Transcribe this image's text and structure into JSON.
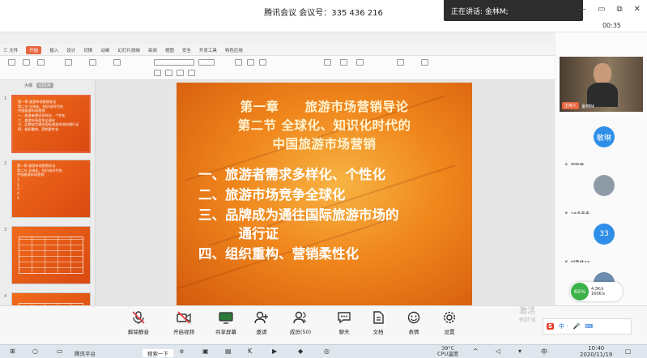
{
  "window": {
    "title": "腾讯会议 会议号：335 436 216",
    "speaking_label": "正在讲话: 金林M;",
    "timer": "00:35",
    "controls": [
      "—",
      "▭",
      "⧉",
      "✕"
    ]
  },
  "ppt": {
    "menu_tabs": [
      "三 文件",
      "开始",
      "插入",
      "设计",
      "切换",
      "动画",
      "幻灯片放映",
      "审阅",
      "视图",
      "安全",
      "开发工具",
      "特色应用"
    ],
    "active_tab": "开始",
    "thumb_tabs": [
      "大纲",
      "幻灯片"
    ],
    "thumbs": [
      {
        "num": "1",
        "lines": [
          "第一章 旅游市场营销导论",
          "第二节 全球化、知识化时代的",
          "中国旅游市场营销",
          "一、旅游者需求多样化、个性化",
          "二、旅游市场竞争全球化",
          "三、品牌成为通往国际旅游市场的通行证",
          "四、组织重构、营销柔性化"
        ]
      },
      {
        "num": "2",
        "lines": [
          "第一章 旅游市场营销导论",
          "第二节 全球化、知识化时代的",
          "中国旅游市场营销",
          "1.",
          "2.",
          "3.",
          "4.",
          "5."
        ]
      },
      {
        "num": "3",
        "lines": []
      },
      {
        "num": "4",
        "lines": []
      }
    ],
    "slide": {
      "titles": [
        "第一章　　旅游市场营销导论",
        "第二节 全球化、知识化时代的",
        "中国旅游市场营销"
      ],
      "bullets": [
        "一、旅游者需求多样化、个性化",
        "二、旅游市场竞争全球化",
        "三、品牌成为通往国际旅游市场的",
        "　　　通行证",
        "四、组织重构、营销柔性化"
      ]
    }
  },
  "participants": {
    "host": {
      "badge": "主持人",
      "name": "金林M"
    },
    "list": [
      {
        "avatar": "敏琳",
        "name": "周敏琳",
        "color": "#2f8fe8"
      },
      {
        "avatar": "",
        "name": "18卓青青",
        "color": "#8e9aa5"
      },
      {
        "avatar": "33",
        "name": "刘秀林33",
        "color": "#2f8fe8"
      },
      {
        "avatar": "",
        "name": "",
        "color": "#6a8cae"
      }
    ]
  },
  "network": {
    "percent": "65%",
    "up": "4.3K/s",
    "down": "160K/s"
  },
  "toolbar": {
    "buttons": [
      "解除静音",
      "开启视频",
      "共享屏幕",
      "邀请",
      "成员(50)",
      "聊天",
      "文档",
      "表情",
      "设置"
    ],
    "watermark_line1": "激活",
    "watermark_line2": "转到\"设"
  },
  "tray": {
    "label": "S",
    "text": "中 ·"
  },
  "taskbar": {
    "search_placeholder": "搜索一下",
    "weather": "39°C",
    "weather_sub": "CPU温度",
    "time": "10:40",
    "date": "2020/11/19",
    "app_label": "腾讯平台"
  },
  "colors": {
    "accent": "#e8663d",
    "slide_orange": "#f0861c",
    "participant_blue": "#2f8fe8"
  }
}
